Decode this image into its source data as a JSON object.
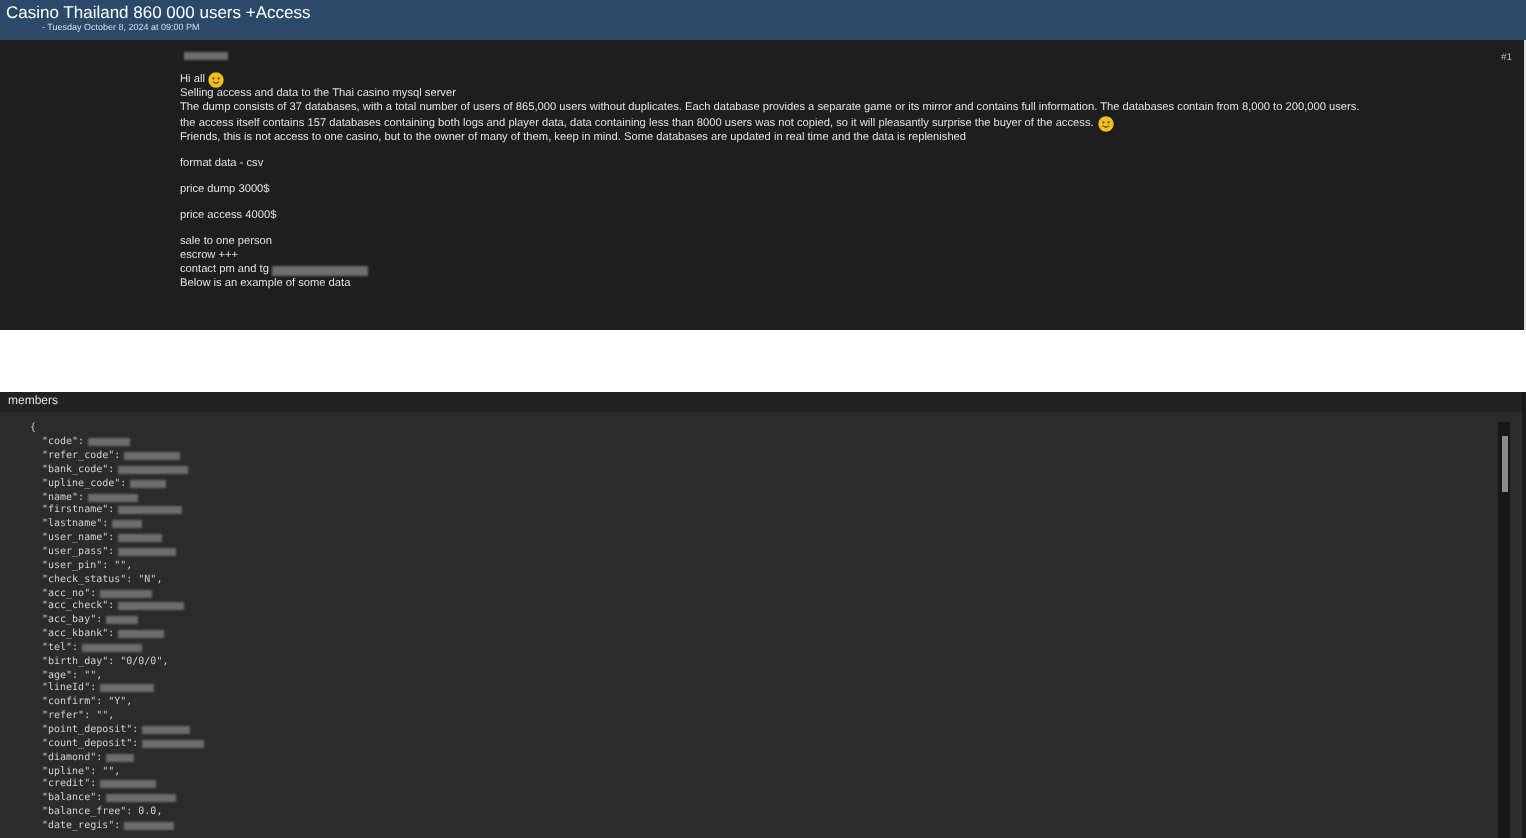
{
  "thread": {
    "title": "Casino Thailand 860 000 users +Access",
    "date": "- Tuesday October 8, 2024 at 09:00 PM"
  },
  "post": {
    "author_redacted": true,
    "number": "#1",
    "blocks": [
      {
        "lines": [
          {
            "text": "Hi all",
            "emoji": true,
            "redacted": false
          },
          {
            "text": "Selling access and data to the Thai casino mysql server",
            "emoji": false,
            "redacted": false
          },
          {
            "text": "The dump consists of 37 databases, with a total number of users of 865,000 users without duplicates. Each database provides a separate game or its mirror and contains full information. The databases contain from 8,000 to 200,000 users.",
            "emoji": false,
            "redacted": false
          },
          {
            "text": "the access itself contains 157 databases containing both logs and player data, data containing less than 8000 users was not copied, so it will pleasantly surprise the buyer of the access.",
            "emoji": true,
            "redacted": false
          },
          {
            "text": "Friends, this is not access to one casino, but to the owner of many of them, keep in mind. Some databases are updated in real time and the data is replenished",
            "emoji": false,
            "redacted": false
          }
        ]
      },
      {
        "lines": [
          {
            "text": "format data - csv",
            "emoji": false,
            "redacted": false
          }
        ]
      },
      {
        "lines": [
          {
            "text": "price dump 3000$",
            "emoji": false,
            "redacted": false
          }
        ]
      },
      {
        "lines": [
          {
            "text": "price access 4000$",
            "emoji": false,
            "redacted": false
          }
        ]
      },
      {
        "lines": [
          {
            "text": "sale to one person",
            "emoji": false,
            "redacted": false
          },
          {
            "text": "escrow +++",
            "emoji": false,
            "redacted": false
          },
          {
            "text": "contact pm and tg",
            "emoji": false,
            "redacted": true
          },
          {
            "text": "Below is an example of some data",
            "emoji": false,
            "redacted": false
          }
        ]
      }
    ]
  },
  "members": {
    "title": "members",
    "lines": [
      {
        "text": "{",
        "redacted": false
      },
      {
        "text": "\"code\":",
        "redacted": true
      },
      {
        "text": "\"refer_code\":",
        "redacted": true
      },
      {
        "text": "\"bank_code\":",
        "redacted": true
      },
      {
        "text": "\"upline_code\":",
        "redacted": true
      },
      {
        "text": "\"name\":",
        "redacted": true
      },
      {
        "text": "\"firstname\":",
        "redacted": true
      },
      {
        "text": "\"lastname\":",
        "redacted": true
      },
      {
        "text": "\"user_name\":",
        "redacted": true
      },
      {
        "text": "\"user_pass\":",
        "redacted": true
      },
      {
        "text": "\"user_pin\": \"\",",
        "redacted": false
      },
      {
        "text": "\"check_status\": \"N\",",
        "redacted": false
      },
      {
        "text": "\"acc_no\":",
        "redacted": true
      },
      {
        "text": "\"acc_check\":",
        "redacted": true
      },
      {
        "text": "\"acc_bay\":",
        "redacted": true
      },
      {
        "text": "\"acc_kbank\":",
        "redacted": true
      },
      {
        "text": "\"tel\":",
        "redacted": true
      },
      {
        "text": "\"birth_day\": \"0/0/0\",",
        "redacted": false
      },
      {
        "text": "\"age\": \"\",",
        "redacted": false
      },
      {
        "text": "\"lineId\":",
        "redacted": true
      },
      {
        "text": "\"confirm\": \"Y\",",
        "redacted": false
      },
      {
        "text": "\"refer\": \"\",",
        "redacted": false
      },
      {
        "text": "\"point_deposit\":",
        "redacted": true
      },
      {
        "text": "\"count_deposit\":",
        "redacted": true
      },
      {
        "text": "\"diamond\":",
        "redacted": true
      },
      {
        "text": "\"upline\": \"\",",
        "redacted": false
      },
      {
        "text": "\"credit\":",
        "redacted": true
      },
      {
        "text": "\"balance\":",
        "redacted": true
      },
      {
        "text": "\"balance_free\": 0.0,",
        "redacted": false
      },
      {
        "text": "\"date_regis\":",
        "redacted": true
      }
    ]
  }
}
